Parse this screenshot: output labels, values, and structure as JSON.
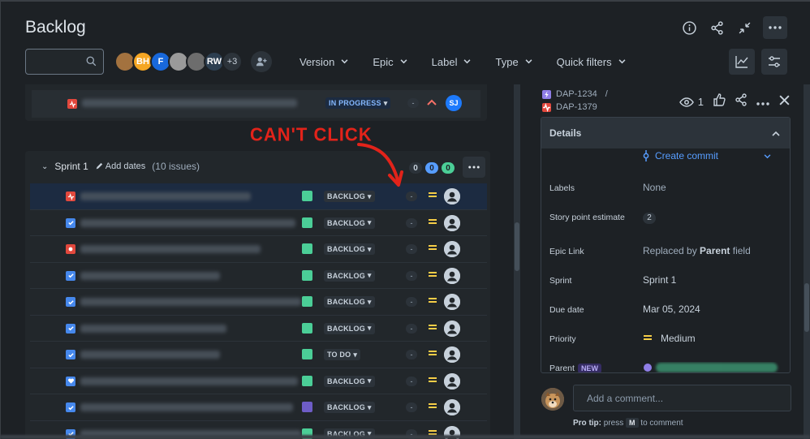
{
  "page": {
    "title": "Backlog"
  },
  "toolbar": {
    "search_placeholder": "",
    "avatars": [
      {
        "kind": "dog",
        "initials": "",
        "color": "#a3723f"
      },
      {
        "kind": "initials",
        "initials": "BH",
        "color": "#f5a623"
      },
      {
        "kind": "initials",
        "initials": "F",
        "color": "#1868db"
      },
      {
        "kind": "photo",
        "initials": "",
        "color": "#9a9a9a"
      },
      {
        "kind": "photo",
        "initials": "",
        "color": "#6d6d6d"
      },
      {
        "kind": "initials",
        "initials": "RW",
        "color": "#2c3e50"
      },
      {
        "kind": "more",
        "initials": "+3",
        "color": "#2c333a"
      }
    ],
    "filters": [
      "Version",
      "Epic",
      "Label",
      "Type",
      "Quick filters"
    ]
  },
  "prev_sprint_row": {
    "status": "IN PROGRESS",
    "assignee": "SJ",
    "dash": "-",
    "assignee_color": "#1d7afc"
  },
  "annotation": {
    "text": "CAN'T CLICK"
  },
  "sprint": {
    "name": "Sprint 1",
    "add_dates": "Add dates",
    "issue_count": "(10 issues)",
    "counts": [
      {
        "value": "0",
        "bg": "#2c333a",
        "fg": "#c7d1db"
      },
      {
        "value": "0",
        "bg": "#579dff",
        "fg": "#1d2125"
      },
      {
        "value": "0",
        "bg": "#4bce97",
        "fg": "#1d2125"
      }
    ]
  },
  "issues": [
    {
      "type": "bug",
      "status": "BACKLOG",
      "epic_color": "#4bce97",
      "dash": "-",
      "selected": true
    },
    {
      "type": "task",
      "status": "BACKLOG",
      "epic_color": "#4bce97",
      "dash": "-",
      "selected": false
    },
    {
      "type": "bug-red",
      "status": "BACKLOG",
      "epic_color": "#4bce97",
      "dash": "-",
      "selected": false
    },
    {
      "type": "task",
      "status": "BACKLOG",
      "epic_color": "#4bce97",
      "dash": "-",
      "selected": false
    },
    {
      "type": "task",
      "status": "BACKLOG",
      "epic_color": "#4bce97",
      "dash": "-",
      "selected": false
    },
    {
      "type": "task",
      "status": "BACKLOG",
      "epic_color": "#4bce97",
      "dash": "-",
      "selected": false
    },
    {
      "type": "task",
      "status": "TO DO",
      "epic_color": "#4bce97",
      "dash": "-",
      "selected": false
    },
    {
      "type": "story",
      "status": "BACKLOG",
      "epic_color": "#4bce97",
      "dash": "-",
      "selected": false
    },
    {
      "type": "task",
      "status": "BACKLOG",
      "epic_color": "#6e5dc6",
      "dash": "-",
      "selected": false
    },
    {
      "type": "task",
      "status": "BACKLOG",
      "epic_color": "#4bce97",
      "dash": "-",
      "selected": false
    }
  ],
  "detail": {
    "breadcrumb": [
      "DAP-1234",
      "/",
      "DAP-1379"
    ],
    "watchers": "1",
    "section_title": "Details",
    "create_commit": "Create commit",
    "fields": [
      {
        "label": "Labels",
        "value": "None"
      },
      {
        "label": "Story point estimate",
        "value": "2"
      },
      {
        "label": "Epic Link",
        "value_prefix": "Replaced by ",
        "value_bold": "Parent",
        "value_suffix": " field"
      },
      {
        "label": "Sprint",
        "value": "Sprint 1"
      },
      {
        "label": "Due date",
        "value": "Mar 05, 2024"
      },
      {
        "label": "Priority",
        "value": "Medium"
      },
      {
        "label": "Parent",
        "badge": "NEW"
      }
    ],
    "comment_placeholder": "Add a comment...",
    "protip_prefix": "Pro tip:",
    "protip_press": " press ",
    "protip_key": "M",
    "protip_suffix": " to comment"
  }
}
